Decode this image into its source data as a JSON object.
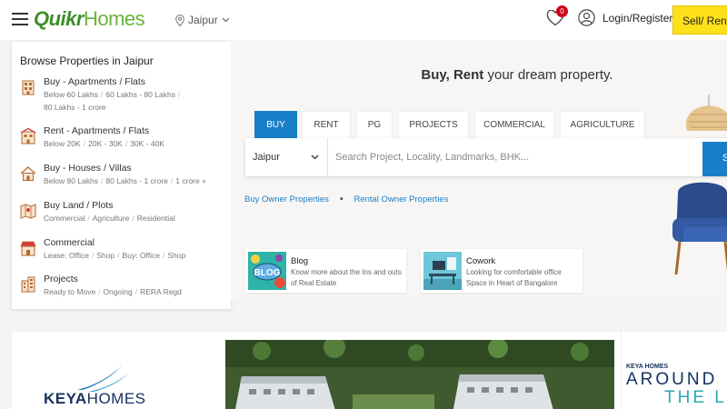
{
  "header": {
    "logo_quikr": "Quikr",
    "logo_homes": "Homes",
    "city": "Jaipur",
    "notification_count": "0",
    "login_label": "Login/Register",
    "sell_label": "Sell/ Rent P"
  },
  "browse": {
    "title": "Browse Properties in Jaipur",
    "items": [
      {
        "title": "Buy - Apartments / Flats",
        "icon": "apartment-icon",
        "subs": [
          "Below 60 Lakhs",
          "60 Lakhs - 80 Lakhs",
          "80 Lakhs - 1 crore"
        ]
      },
      {
        "title": "Rent - Apartments / Flats",
        "icon": "rent-apartment-icon",
        "subs": [
          "Below 20K",
          "20K - 30K",
          "30K - 40K"
        ]
      },
      {
        "title": "Buy - Houses / Villas",
        "icon": "house-icon",
        "subs": [
          "Below 80 Lakhs",
          "80 Lakhs - 1 crore",
          "1 crore +"
        ]
      },
      {
        "title": "Buy Land / Plots",
        "icon": "land-plot-icon",
        "subs": [
          "Commercial",
          "Agriculture",
          "Residential"
        ]
      },
      {
        "title": "Commercial",
        "icon": "shop-icon",
        "subs": [
          "Lease: Office",
          "Shop",
          "Buy: Office",
          "Shop"
        ]
      },
      {
        "title": "Projects",
        "icon": "building-icon",
        "subs": [
          "Ready to Move",
          "Ongoing",
          "RERA Regd"
        ]
      }
    ]
  },
  "hero": {
    "title_bold": "Buy, Rent",
    "title_rest": " your dream property.",
    "tabs": [
      "BUY",
      "RENT",
      "PG",
      "PROJECTS",
      "COMMERCIAL",
      "AGRICULTURE"
    ],
    "active_tab": "BUY",
    "search_city": "Jaipur",
    "search_placeholder": "Search Project, Locality, Landmarks, BHK...",
    "search_button": "S",
    "owner_links": [
      "Buy Owner Properties",
      "Rental Owner Properties"
    ]
  },
  "cards": [
    {
      "title": "Blog",
      "desc": "Know more about the Ins and outs of Real Estate",
      "img_text": "BLOG"
    },
    {
      "title": "Cowork",
      "desc": "Looking for comfortable office Space in Heart of Bangalore"
    }
  ],
  "banner": {
    "brand_keya": "KEYA",
    "brand_homes": "HOMES",
    "ad_brand": "KEYA HOMES",
    "ad_line1": "AROUND",
    "ad_line2": "THE LI"
  },
  "colors": {
    "accent": "#1a7fc9",
    "logo_green": "#3e8f2b",
    "sell_yellow": "#ffe11b",
    "badge_red": "#d0021b"
  }
}
